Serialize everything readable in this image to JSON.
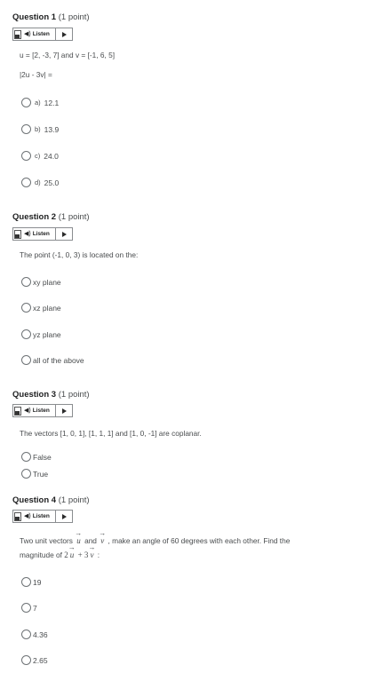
{
  "listen_label": "Listen",
  "questions": [
    {
      "title": "Question 1",
      "points": "(1 point)",
      "prompt_lines": [
        "u = [2, -3, 7] and v = [-1, 6, 5]",
        "|2u - 3v| ="
      ],
      "options": [
        {
          "letter": "a)",
          "value": "12.1"
        },
        {
          "letter": "b)",
          "value": "13.9"
        },
        {
          "letter": "c)",
          "value": "24.0"
        },
        {
          "letter": "d)",
          "value": "25.0"
        }
      ]
    },
    {
      "title": "Question 2",
      "points": "(1 point)",
      "prompt": "The point (-1, 0, 3) is located on the:",
      "options": [
        "xy plane",
        "xz plane",
        "yz plane",
        "all of the above"
      ]
    },
    {
      "title": "Question 3",
      "points": "(1 point)",
      "prompt": "The vectors [1, 0, 1], [1, 1, 1] and [1, 0, -1] are coplanar.",
      "options": [
        "False",
        "True"
      ]
    },
    {
      "title": "Question 4",
      "points": "(1 point)",
      "prompt": {
        "part1": "Two unit vectors",
        "u": "u",
        "and": "and",
        "v": "v",
        "part2": ", make an angle of 60 degrees with each other. Find the",
        "part3": "magnitude of",
        "expr_2": "2",
        "expr_plus3": "+ 3",
        "colon": ":"
      },
      "options": [
        "19",
        "7",
        "4.36",
        "2.65"
      ]
    }
  ]
}
